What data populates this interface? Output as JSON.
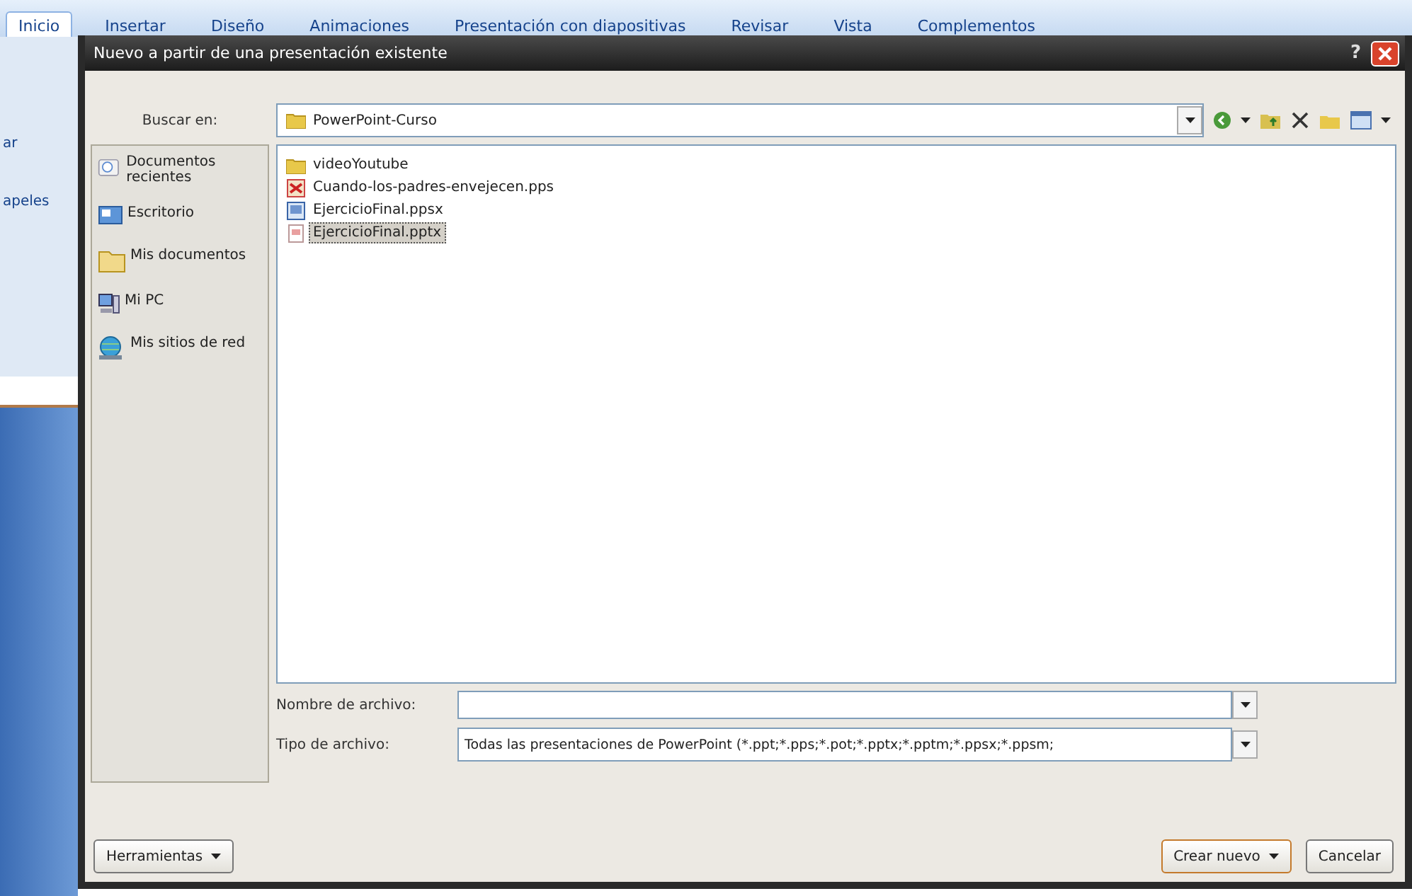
{
  "app": {
    "ribbon_tabs": [
      {
        "label": "Inicio",
        "selected": true
      },
      {
        "label": "Insertar",
        "selected": false
      },
      {
        "label": "Diseño",
        "selected": false
      },
      {
        "label": "Animaciones",
        "selected": false
      },
      {
        "label": "Presentación con diapositivas",
        "selected": false
      },
      {
        "label": "Revisar",
        "selected": false
      },
      {
        "label": "Vista",
        "selected": false
      },
      {
        "label": "Complementos",
        "selected": false
      }
    ],
    "left_strip": [
      "ar",
      "apeles"
    ]
  },
  "dialog": {
    "title": "Nuevo a partir de una presentación existente",
    "help": "?",
    "look_in": {
      "label": "Buscar en:",
      "value": "PowerPoint-Curso"
    },
    "places": [
      {
        "label": "Documentos recientes",
        "kind": "recent"
      },
      {
        "label": "Escritorio",
        "kind": "desktop"
      },
      {
        "label": "Mis documentos",
        "kind": "documents"
      },
      {
        "label": "Mi PC",
        "kind": "computer"
      },
      {
        "label": "Mis sitios de red",
        "kind": "network"
      }
    ],
    "files": [
      {
        "name": "videoYoutube",
        "kind": "folder",
        "selected": false
      },
      {
        "name": "Cuando-los-padres-envejecen.pps",
        "kind": "pps",
        "selected": false
      },
      {
        "name": "EjercicioFinal.ppsx",
        "kind": "ppsx",
        "selected": false
      },
      {
        "name": "EjercicioFinal.pptx",
        "kind": "pptx",
        "selected": true
      }
    ],
    "file_name": {
      "label": "Nombre de archivo:"
    },
    "file_type": {
      "label": "Tipo de archivo:",
      "value": "Todas las presentaciones de PowerPoint (*.ppt;*.pps;*.pot;*.pptx;*.pptm;*.ppsx;*.ppsm;"
    },
    "buttons": [
      {
        "label": "Herramientas",
        "kind": "tools"
      },
      {
        "label": "Crear nuevo",
        "kind": "create"
      },
      {
        "label": "Cancelar",
        "kind": "cancel"
      }
    ]
  }
}
